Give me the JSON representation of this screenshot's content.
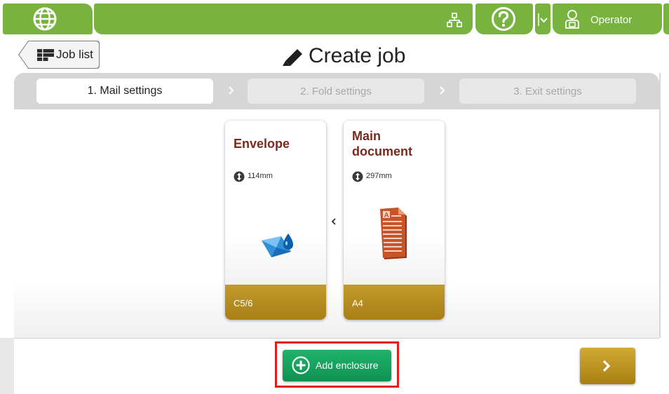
{
  "topbar": {
    "operator_label": "Operator",
    "icons": [
      "globe-icon",
      "network-icon",
      "help-icon",
      "chevron-down-icon",
      "operator-icon"
    ],
    "bar_color": "#78b33f"
  },
  "header": {
    "back_label": "Job list",
    "title": "Create job"
  },
  "steps": [
    {
      "label": "1. Mail settings",
      "state": "active"
    },
    {
      "label": "2. Fold settings",
      "state": "disabled"
    },
    {
      "label": "3. Exit settings",
      "state": "disabled"
    }
  ],
  "cards": [
    {
      "title": "Envelope",
      "size": "114mm",
      "format": "C5/6",
      "icon": "envelope-icon"
    },
    {
      "title": "Main\ndocument",
      "title_line1": "Main",
      "title_line2": "document",
      "size": "297mm",
      "format": "A4",
      "icon": "document-icon"
    }
  ],
  "footer": {
    "add_label": "Add enclosure",
    "add_color": "#15a35d",
    "next_color": "#c39b25",
    "highlight_color": "#e31b1b"
  }
}
